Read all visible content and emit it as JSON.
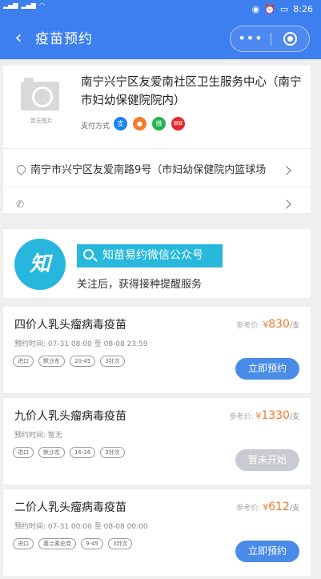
{
  "status": {
    "time": "8:26"
  },
  "nav": {
    "back_icon": "‹",
    "title": "疫苗预约",
    "more_icon": "•••"
  },
  "hospital": {
    "no_image_text": "暂无图片",
    "name": "南宁兴宁区友爱南社区卫生服务中心（南宁市妇幼保健院院内）",
    "pay_label": "支付方式",
    "pay_methods": [
      {
        "glyph": "支",
        "color": "#1b84f3"
      },
      {
        "glyph": "●",
        "color": "#f37c2b"
      },
      {
        "glyph": "微",
        "color": "#21b64b"
      },
      {
        "glyph": "银联",
        "color": "#e5262c"
      }
    ],
    "address": "南宁市兴宁区友爱南路9号（市妇幼保健院内篮球场",
    "phone": ""
  },
  "promo": {
    "logo_text": "知",
    "badge": "知苗易约微信公众号",
    "subtitle": "关注后，获得接种提醒服务"
  },
  "vaccines": [
    {
      "name": "四价人乳头瘤病毒疫苗",
      "price_label": "参考价:",
      "currency": "¥",
      "price": "830",
      "unit": "/支",
      "time_label": "预约时间:",
      "time": "07-31 08:00 至 08-08 23:59",
      "tags": [
        "进口",
        "默沙东",
        "20-45",
        "3针次"
      ],
      "button": "立即预约",
      "enabled": true
    },
    {
      "name": "九价人乳头瘤病毒疫苗",
      "price_label": "参考价:",
      "currency": "¥",
      "price": "1330",
      "unit": "/支",
      "time_label": "预约时间:",
      "time": "暂无",
      "tags": [
        "进口",
        "默沙东",
        "16-26",
        "3针次"
      ],
      "button": "暂未开始",
      "enabled": false
    },
    {
      "name": "二价人乳头瘤病毒疫苗",
      "price_label": "参考价:",
      "currency": "¥",
      "price": "612",
      "unit": "/支",
      "time_label": "预约时间:",
      "time": "07-31 00:00 至 08-08 00:00",
      "tags": [
        "进口",
        "葛兰素史克",
        "9-45",
        "3针次"
      ],
      "button": "立即预约",
      "enabled": true
    }
  ]
}
